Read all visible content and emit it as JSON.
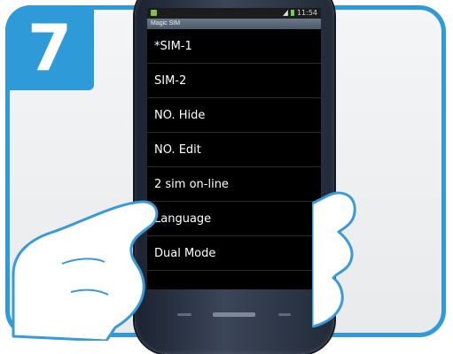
{
  "step": {
    "number": "7"
  },
  "screen": {
    "status_time": "11:54",
    "title": "Magic SIM",
    "menu": [
      {
        "label": "*SIM-1"
      },
      {
        "label": "SIM-2"
      },
      {
        "label": "NO. Hide"
      },
      {
        "label": "NO. Edit"
      },
      {
        "label": "2 sim on-line"
      },
      {
        "label": "Language"
      },
      {
        "label": "Dual Mode"
      }
    ]
  },
  "colors": {
    "frame_blue": "#2f9ad8",
    "screen_bg": "#000000",
    "menu_text": "#ffffff"
  },
  "icons": [
    "signal-icon",
    "battery-icon",
    "app-icon",
    "back-icon",
    "menu-icon",
    "home-button"
  ]
}
